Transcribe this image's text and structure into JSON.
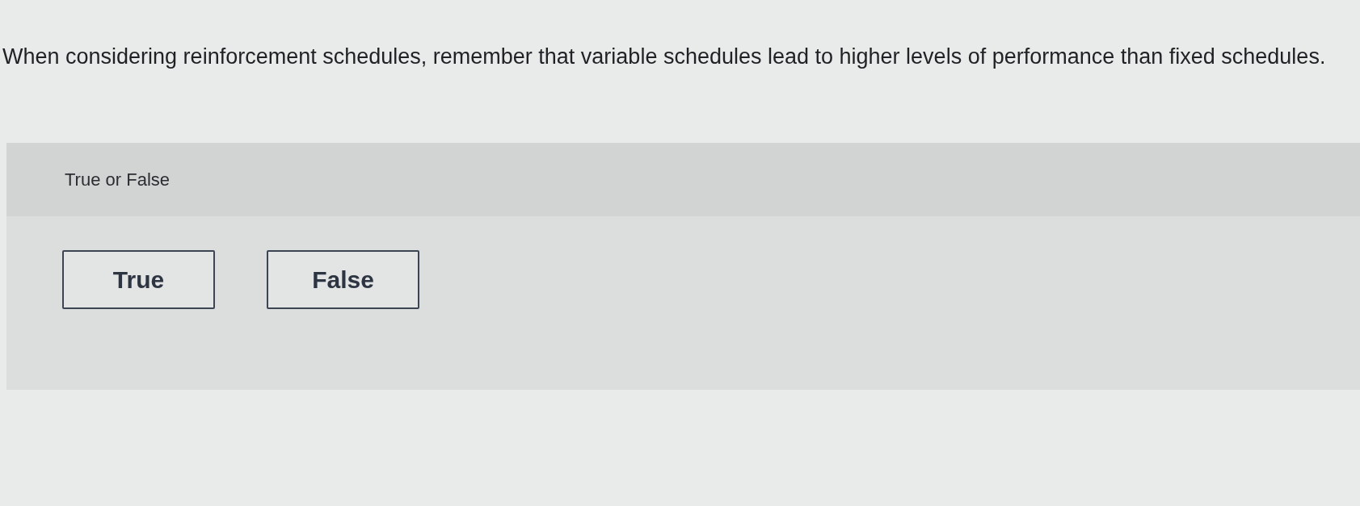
{
  "question": {
    "text": "When considering reinforcement schedules, remember that variable schedules lead to higher levels of performance than fixed schedules."
  },
  "prompt": {
    "text": "True or False"
  },
  "options": [
    {
      "label": "True",
      "selected": false
    },
    {
      "label": "False",
      "selected": false
    }
  ]
}
